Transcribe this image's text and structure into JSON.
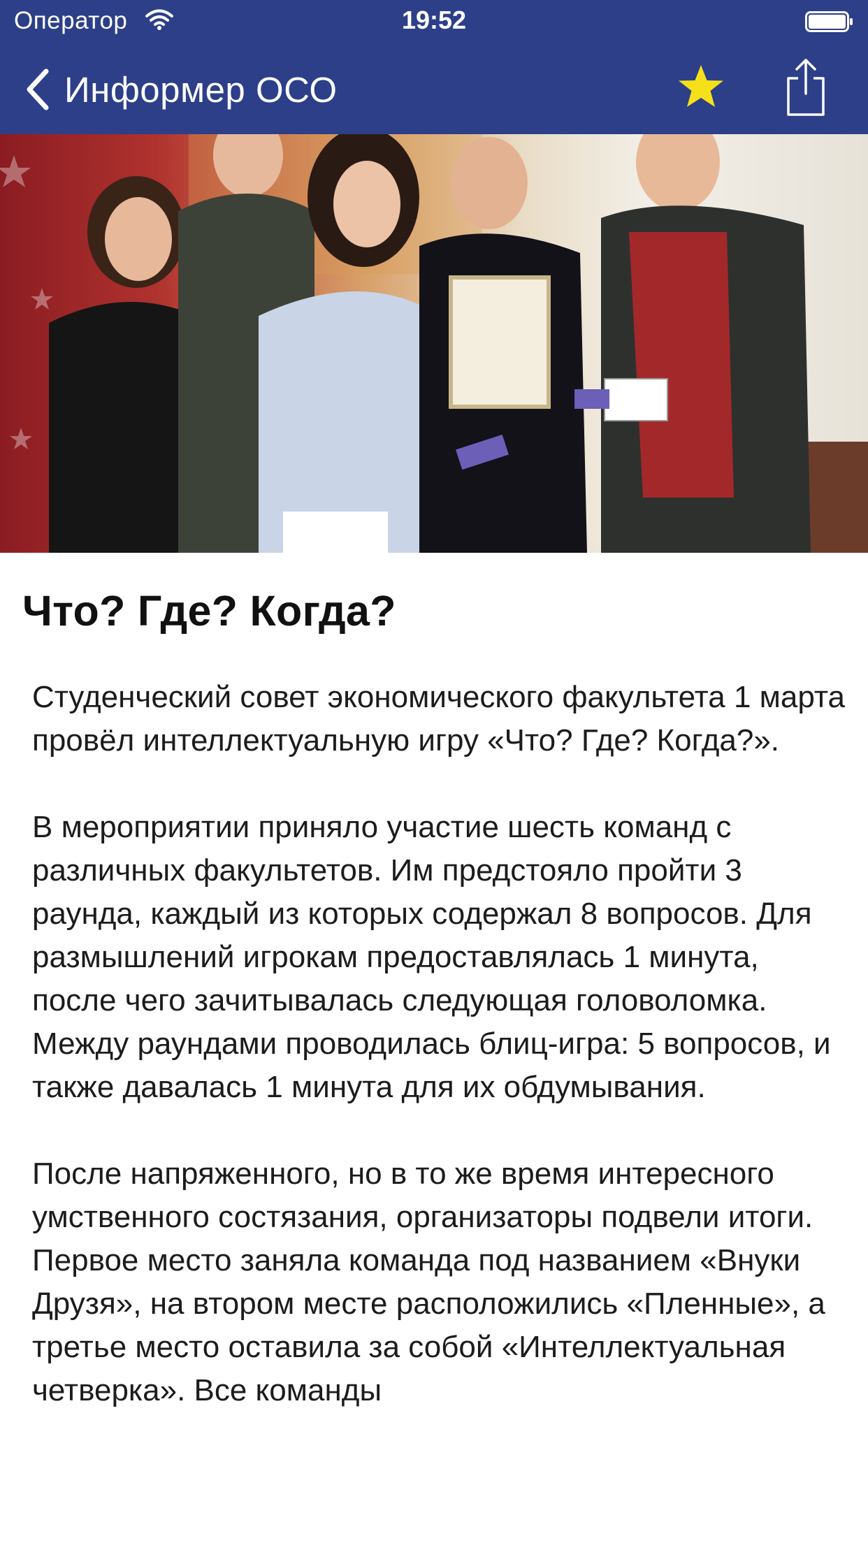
{
  "status_bar": {
    "carrier": "Оператор",
    "time": "19:52"
  },
  "nav_bar": {
    "back_label": "Информер ОСО",
    "favorite_icon": "star-icon",
    "share_icon": "share-icon",
    "bar_color": "#2c3f88",
    "star_color": "#f6e01a"
  },
  "hero_image": {
    "description_icon": "photo"
  },
  "article": {
    "title": "Что? Где? Когда?",
    "paragraphs": [
      "Студенческий совет экономического факультета 1 марта провёл интеллектуальную игру «Что? Где? Когда?».",
      "В мероприятии приняло участие шесть команд с различных факультетов. Им предстояло пройти 3 раунда, каждый из которых содержал 8 вопросов. Для размышлений игрокам предоставлялась 1 минута, после чего зачитывалась следующая головоломка. Между раундами проводилась блиц-игра: 5 вопросов, и также давалась 1 минута для их обдумывания.",
      "После напряженного, но в то же время интересного умственного состязания, организаторы подвели итоги. Первое место заняла команда под названием «Внуки Друзя», на втором месте расположились «Пленные», а третье место оставила за собой «Интеллектуальная четверка». Все команды"
    ]
  }
}
